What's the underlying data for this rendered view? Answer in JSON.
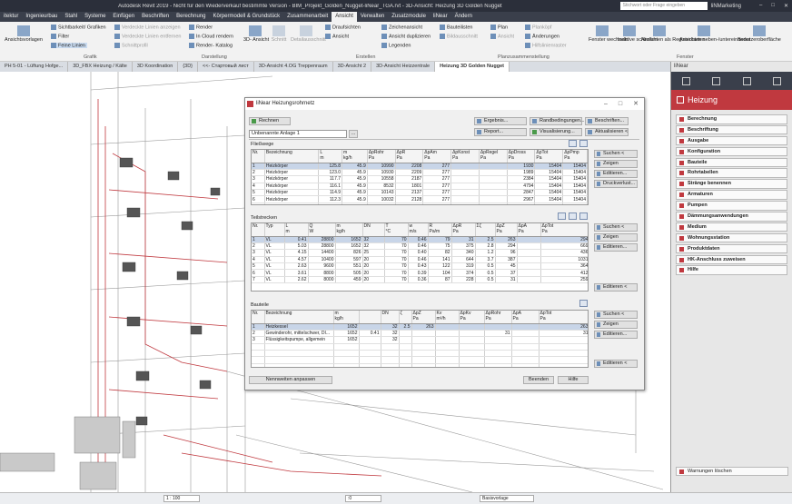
{
  "window": {
    "title": "Autodesk Revit 2019 - Nicht für den Wiederverkauf bestimmte Version - BIM_Projekt_Golden_Nugget-liNear_TGA.rvt - 3D-Ansicht: Heizung 3D Golden Nugget",
    "search_placeholder": "Stichwort oder Frage eingeben",
    "user": "liNMarketing"
  },
  "menu": [
    "itektur",
    "Ingenieurbau",
    "Stahl",
    "Systeme",
    "Einfügen",
    "Beschriften",
    "Berechnung",
    "Körpermodell & Grundstück",
    "Zusammenarbeit",
    "Ansicht",
    "Verwalten",
    "Zusatzmodule",
    "liNear",
    "Ändern"
  ],
  "menu_active": "Ansicht",
  "ribbon": {
    "items": [
      "Ansichtsvorlagen",
      "Sichtbarkeit/ Grafiken",
      "Filter",
      "Feine Linien",
      "Verdeckte Linien anzeigen",
      "Verdeckte Linien entfernen",
      "Schnittprofil",
      "Render",
      "In Cloud rendern",
      "Render- Katalog",
      "3D- Ansicht",
      "Schnitt",
      "Detailausschnitt",
      "Draufsichten",
      "Ansicht",
      "Zeichenansicht",
      "Ansicht duplizieren",
      "Legenden",
      "Bauteilisten",
      "Bildausschnitt",
      "Plan",
      "Ansicht",
      "Planköpf",
      "Änderungen",
      "Hilfslinienraster",
      "Fenster wechseln",
      "Inaktive schließen",
      "Ansichten als Registerkarten",
      "Ansichten neben-/untereinander",
      "Benutzeroberfläche"
    ],
    "groups": [
      "Grafik",
      "Darstellung",
      "Erstellen",
      "Planzusammenstellung",
      "Fenster"
    ]
  },
  "tabs": [
    "PH 5-01 - Lüftung Hofge...",
    "3D_FBX Heizung / Kälte",
    "3D Koordination",
    "{3D}",
    "<<- Стартовый лист",
    "3D-Ansicht 4.OG Treppenraum",
    "3D-Ansicht 2",
    "3D-Ansicht Heizzentrale",
    "Heizung 3D Golden Nugget"
  ],
  "tab_active": "Heizung 3D Golden Nugget",
  "sidebar": {
    "top_label": "liNear",
    "header": "Heizung",
    "items": [
      "Berechnung",
      "Beschriftung",
      "Ausgabe",
      "Konfiguration",
      "Bauteile",
      "Rohrtabellen",
      "Stränge benennen",
      "Armaturen",
      "Pumpen",
      "Dämmungsanwendungen",
      "Medium",
      "Wohnungsstation",
      "Produktdaten",
      "HK-Anschluss zuweisen",
      "Hilfe"
    ],
    "warnings": "Warnungen löschen"
  },
  "dialog": {
    "title": "liNear Heizungsrohrnetz",
    "rechnen": "Rechnen",
    "combo_value": "Unbenannte Anlage 1",
    "combo_btn": "...",
    "top_buttons": [
      "Ergebnis...",
      "Randbedingungen...",
      "Beschriften...",
      "Report...",
      "Visualisierung...",
      "Aktualisieren <"
    ],
    "fliesswege": {
      "label": "Fließwege",
      "headers": [
        "Nr.",
        "Bezeichnung",
        "L\nm",
        "m\nkg/h",
        "ΔpRohr\nPa",
        "ΔpR\nPa",
        "ΔpAm\nPa",
        "ΔpKonst\nPa",
        "ΔpRegel\nPa",
        "ΔpDross\nPa",
        "ΔpTot\nPa",
        "ΔpPmp\nPa"
      ],
      "rows": [
        [
          "1",
          "Heizkörper",
          "125.8",
          "45.9",
          "10990",
          "2208",
          "277",
          "",
          "",
          "1930",
          "15404",
          "15404"
        ],
        [
          "2",
          "Heizkörper",
          "123.0",
          "45.9",
          "10930",
          "2209",
          "277",
          "",
          "",
          "1989",
          "15404",
          "15404"
        ],
        [
          "3",
          "Heizkörper",
          "117.7",
          "45.9",
          "10558",
          "2187",
          "277",
          "",
          "",
          "2384",
          "15404",
          "15404"
        ],
        [
          "4",
          "Heizkörper",
          "116.1",
          "45.9",
          "8532",
          "1801",
          "277",
          "",
          "",
          "4794",
          "15404",
          "15404"
        ],
        [
          "5",
          "Heizkörper",
          "114.9",
          "45.9",
          "10143",
          "2137",
          "277",
          "",
          "",
          "2847",
          "15404",
          "15404"
        ],
        [
          "6",
          "Heizkörper",
          "112.3",
          "45.9",
          "10032",
          "2128",
          "277",
          "",
          "",
          "2967",
          "15404",
          "15404"
        ]
      ],
      "side_buttons": [
        "Suchen <",
        "Zeigen",
        "Editieren...",
        "Druckverlust..."
      ]
    },
    "teilstrecken": {
      "label": "Teilstrecken",
      "headers": [
        "Nr.",
        "Typ",
        "L\nm",
        "Q\nW",
        "m\nkg/h",
        "DN",
        "T\n°C",
        "w\nm/s",
        "R\nPa/m",
        "ΔpR\nPa",
        "Σζ",
        "ΔpZ\nPa",
        "ΔpA\nPa",
        "ΔpTot\nPa"
      ],
      "rows": [
        [
          "1",
          "VL",
          "0.41",
          "28800",
          "1652",
          "32",
          "70",
          "0.46",
          "79",
          "31",
          "2.5",
          "263",
          "",
          "294"
        ],
        [
          "2",
          "VL",
          "5.03",
          "28800",
          "1652",
          "32",
          "70",
          "0.46",
          "75",
          "375",
          "2.8",
          "294",
          "",
          "669"
        ],
        [
          "3",
          "VL",
          "4.15",
          "14400",
          "826",
          "25",
          "70",
          "0.40",
          "82",
          "340",
          "1.2",
          "96",
          "",
          "436"
        ],
        [
          "4",
          "VL",
          "4.57",
          "10400",
          "597",
          "20",
          "70",
          "0.46",
          "141",
          "644",
          "3.7",
          "387",
          "",
          "1031"
        ],
        [
          "5",
          "VL",
          "2.63",
          "9600",
          "551",
          "20",
          "70",
          "0.43",
          "122",
          "319",
          "0.5",
          "45",
          "",
          "364"
        ],
        [
          "6",
          "VL",
          "3.61",
          "8800",
          "505",
          "20",
          "70",
          "0.39",
          "104",
          "374",
          "0.5",
          "37",
          "",
          "412"
        ],
        [
          "7",
          "VL",
          "2.62",
          "8000",
          "459",
          "20",
          "70",
          "0.36",
          "87",
          "228",
          "0.5",
          "31",
          "",
          "259"
        ]
      ],
      "side_buttons": [
        "Suchen <",
        "Zeigen",
        "Editieren...",
        "Editieren <"
      ]
    },
    "bauteile": {
      "label": "Bauteile",
      "headers": [
        "Nr.",
        "Bezeichnung",
        "m\nkg/h",
        "",
        "DN",
        "ζ",
        "ΔpZ\nPa",
        "Kv\nm³/h",
        "ΔpKv\nPa",
        "ΔpRohr\nPa",
        "ΔpA\nPa",
        "ΔpTot\nPa"
      ],
      "rows": [
        [
          "1",
          "Heizkessel",
          "1652",
          "",
          "32",
          "2.5",
          "263",
          "",
          "",
          "",
          "",
          "263"
        ],
        [
          "2",
          "Gewinderohr, mittelschwer, DI...",
          "1652",
          "0.41",
          "32",
          "",
          "",
          "",
          "",
          "31",
          "",
          "31"
        ],
        [
          "3",
          "Flüssigkeitspumpe, allgemein",
          "1652",
          "",
          "32",
          "",
          "",
          "",
          "",
          "",
          "",
          ""
        ]
      ],
      "side_buttons": [
        "Suchen <",
        "Zeigen",
        "Editieren...",
        "Editieren <"
      ]
    },
    "bottom": {
      "nennweiten": "Nennweiten anpassen",
      "beenden": "Beenden",
      "hilfe": "Hilfe"
    }
  },
  "statusbar": {
    "scale": "1 : 100",
    "zoom": ":0",
    "view_template": "Basisvorlage"
  }
}
